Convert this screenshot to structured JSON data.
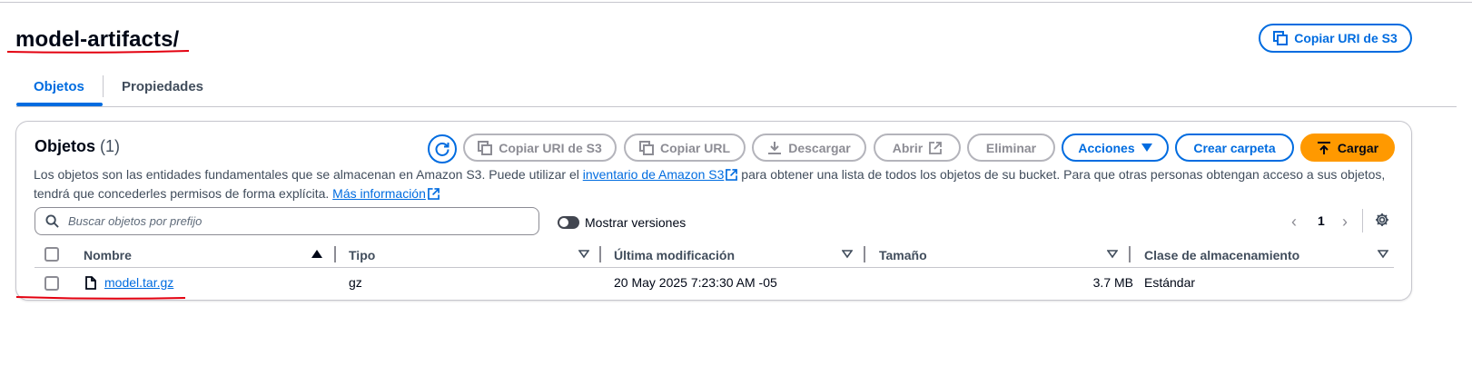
{
  "page": {
    "title": "model-artifacts/",
    "copy_uri_button": "Copiar URI de S3"
  },
  "tabs": [
    {
      "label": "Objetos",
      "active": true
    },
    {
      "label": "Propiedades",
      "active": false
    }
  ],
  "objects_panel": {
    "title": "Objetos",
    "count": "(1)",
    "toolbar": {
      "refresh_icon": "refresh-icon",
      "copy_uri": "Copiar URI de S3",
      "copy_url": "Copiar URL",
      "download": "Descargar",
      "open": "Abrir",
      "delete": "Eliminar",
      "actions": "Acciones",
      "create_folder": "Crear carpeta",
      "upload": "Cargar"
    },
    "description": {
      "part1": "Los objetos son las entidades fundamentales que se almacenan en Amazon S3. Puede utilizar el ",
      "link1": "inventario de Amazon S3",
      "part2": " para obtener una lista de todos los objetos de su bucket. Para que otras personas obtengan acceso a sus objetos, tendrá que concederles permisos de forma explícita. ",
      "link2": "Más información"
    },
    "search": {
      "placeholder": "Buscar objetos por prefijo"
    },
    "show_versions": {
      "label": "Mostrar versiones",
      "on": false
    },
    "pagination": {
      "current_page": "1"
    },
    "table": {
      "columns": [
        "Nombre",
        "Tipo",
        "Última modificación",
        "Tamaño",
        "Clase de almacenamiento"
      ],
      "rows": [
        {
          "name": "model.tar.gz",
          "type": "gz",
          "last_modified": "20 May 2025 7:23:30 AM -05",
          "size": "3.7 MB",
          "storage_class": "Estándar"
        }
      ]
    }
  },
  "colors": {
    "link_blue": "#006ce0",
    "upload_orange": "#ff9900",
    "annotation_red": "#e3000f",
    "disabled_gray": "#8c8c94"
  }
}
